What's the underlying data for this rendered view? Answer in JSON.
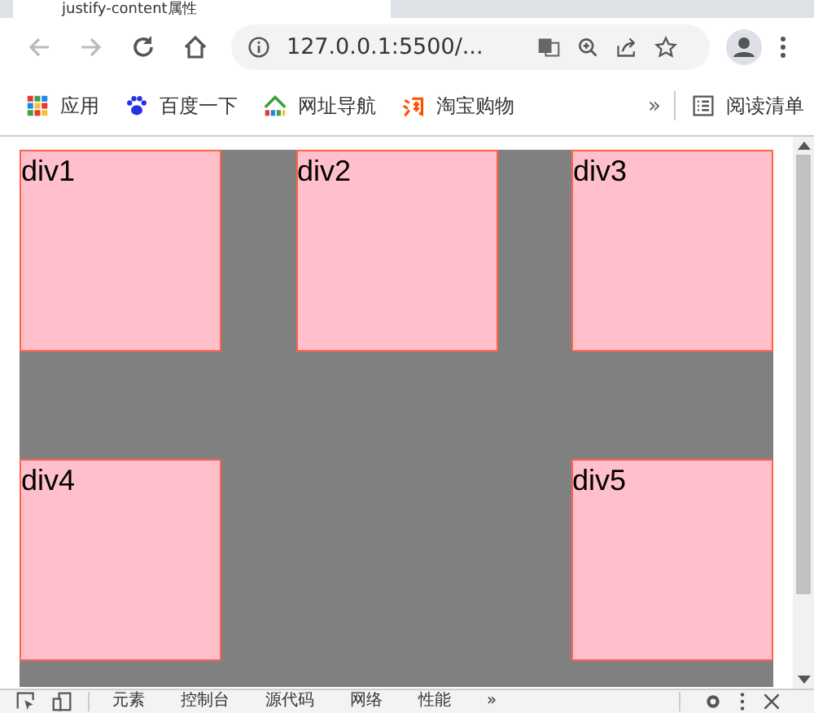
{
  "browser_tab": {
    "title": "justify-content属性"
  },
  "toolbar": {
    "address": "127.0.0.1:5500/..."
  },
  "bookmarks": [
    {
      "label": "应用",
      "kind": "apps"
    },
    {
      "label": "百度一下",
      "kind": "paw"
    },
    {
      "label": "网址导航",
      "kind": "house"
    },
    {
      "label": "淘宝购物",
      "kind": "tao"
    }
  ],
  "reading_list": {
    "more": "»",
    "label": "阅读清单"
  },
  "page": {
    "boxes": [
      "div1",
      "div2",
      "div3",
      "div4",
      "div5"
    ]
  },
  "devtools": {
    "tabs": [
      "元素",
      "控制台",
      "源代码",
      "网络",
      "性能",
      "»"
    ]
  }
}
